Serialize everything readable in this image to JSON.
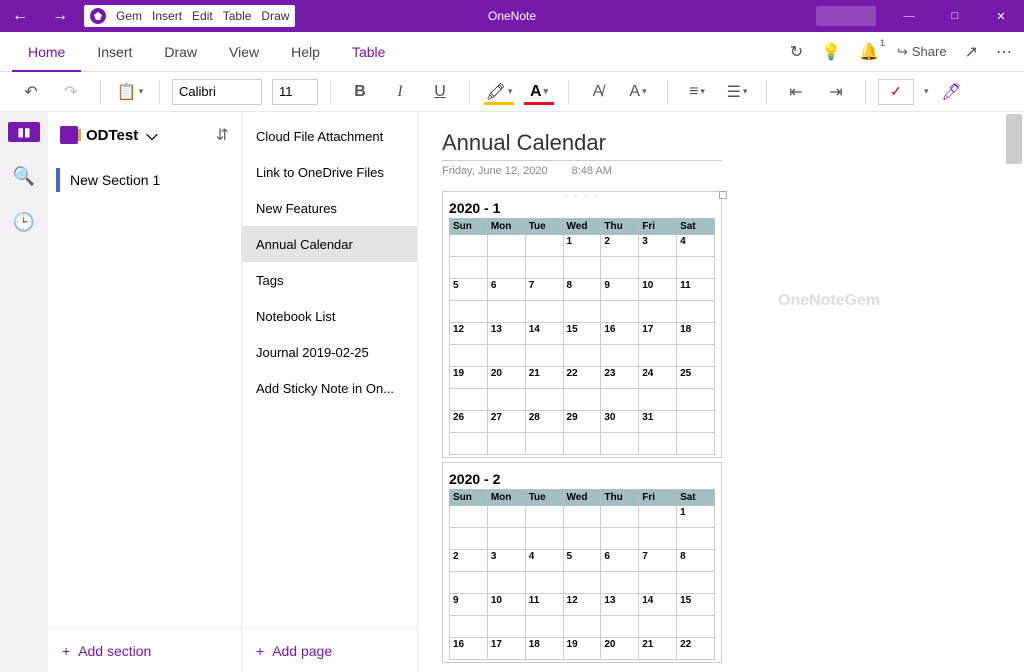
{
  "app": {
    "title": "OneNote"
  },
  "titlebar": {
    "gem_menu": [
      "Gem",
      "Insert",
      "Edit",
      "Table",
      "Draw"
    ]
  },
  "ribbon_tabs": {
    "tabs": [
      "Home",
      "Insert",
      "Draw",
      "View",
      "Help",
      "Table"
    ],
    "active_index": 0,
    "share_label": "Share",
    "bell_badge": "1"
  },
  "ribbon": {
    "font_name": "Calibri",
    "font_size": "11"
  },
  "notebook": {
    "name": "ODTest"
  },
  "sections": {
    "items": [
      {
        "label": "New Section 1"
      }
    ],
    "add_label": "Add section"
  },
  "pages": {
    "items": [
      {
        "label": "Cloud File Attachment"
      },
      {
        "label": "Link to OneDrive Files"
      },
      {
        "label": "New Features"
      },
      {
        "label": "Annual Calendar"
      },
      {
        "label": "Tags"
      },
      {
        "label": "Notebook List"
      },
      {
        "label": "Journal 2019-02-25"
      },
      {
        "label": "Add Sticky Note in On..."
      }
    ],
    "active_index": 3,
    "add_label": "Add page"
  },
  "page": {
    "title": "Annual Calendar",
    "date": "Friday, June 12, 2020",
    "time": "8:48 AM"
  },
  "watermark": "OneNoteGem",
  "calendars": [
    {
      "title": "2020 - 1",
      "days": [
        "Sun",
        "Mon",
        "Tue",
        "Wed",
        "Thu",
        "Fri",
        "Sat"
      ],
      "rows": [
        [
          "",
          "",
          "",
          "1",
          "2",
          "3",
          "4"
        ],
        [
          "",
          "",
          "",
          "",
          "",
          "",
          ""
        ],
        [
          "5",
          "6",
          "7",
          "8",
          "9",
          "10",
          "11"
        ],
        [
          "",
          "",
          "",
          "",
          "",
          "",
          ""
        ],
        [
          "12",
          "13",
          "14",
          "15",
          "16",
          "17",
          "18"
        ],
        [
          "",
          "",
          "",
          "",
          "",
          "",
          ""
        ],
        [
          "19",
          "20",
          "21",
          "22",
          "23",
          "24",
          "25"
        ],
        [
          "",
          "",
          "",
          "",
          "",
          "",
          ""
        ],
        [
          "26",
          "27",
          "28",
          "29",
          "30",
          "31",
          ""
        ],
        [
          "",
          "",
          "",
          "",
          "",
          "",
          ""
        ]
      ]
    },
    {
      "title": "2020 - 2",
      "days": [
        "Sun",
        "Mon",
        "Tue",
        "Wed",
        "Thu",
        "Fri",
        "Sat"
      ],
      "rows": [
        [
          "",
          "",
          "",
          "",
          "",
          "",
          "1"
        ],
        [
          "",
          "",
          "",
          "",
          "",
          "",
          ""
        ],
        [
          "2",
          "3",
          "4",
          "5",
          "6",
          "7",
          "8"
        ],
        [
          "",
          "",
          "",
          "",
          "",
          "",
          ""
        ],
        [
          "9",
          "10",
          "11",
          "12",
          "13",
          "14",
          "15"
        ],
        [
          "",
          "",
          "",
          "",
          "",
          "",
          ""
        ],
        [
          "16",
          "17",
          "18",
          "19",
          "20",
          "21",
          "22"
        ]
      ]
    }
  ]
}
